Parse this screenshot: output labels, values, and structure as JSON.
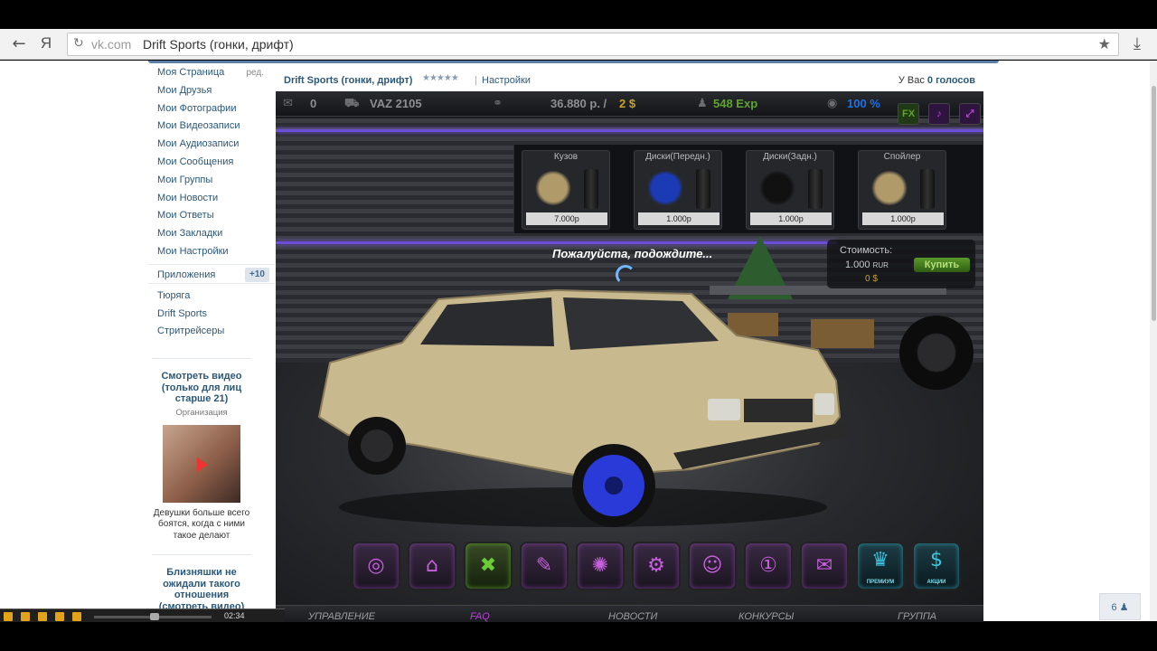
{
  "browser": {
    "url_host": "vk.com",
    "page_title": "Drift Sports (гонки, дрифт)",
    "search_letter": "Я"
  },
  "sidebar": {
    "edit_label": "ред.",
    "items": [
      "Моя Страница",
      "Мои Друзья",
      "Мои Фотографии",
      "Мои Видеозаписи",
      "Мои Аудиозаписи",
      "Мои Сообщения",
      "Мои Группы",
      "Мои Новости",
      "Мои Ответы",
      "Мои Закладки",
      "Мои Настройки"
    ],
    "apps_label": "Приложения",
    "apps_badge": "+10",
    "app_links": [
      "Тюряга",
      "Drift Sports",
      "Стритрейсеры"
    ]
  },
  "ads": [
    {
      "title": "Смотреть видео (только для лиц старше 21)",
      "subtitle": "Организация",
      "desc": "Девушки больше всего боятся, когда с ними такое делают"
    },
    {
      "title": "Близняшки не ожидали такого отношения (смотреть видео)"
    }
  ],
  "app_header": {
    "name": "Drift Sports (гонки, дрифт)",
    "rating_stars": "★★★★★",
    "settings": "Настройки",
    "votes_prefix": "У Вас ",
    "votes_value": "0 голосов"
  },
  "game": {
    "hud": {
      "messages": "0",
      "car": "VAZ 2105",
      "money": "36.880 р. /",
      "gold": "2 $",
      "exp": "548 Exp",
      "fuel": "100 %",
      "fx": "FX"
    },
    "parts": [
      {
        "label": "Кузов",
        "price": "7.000р",
        "color": "#b09a6a"
      },
      {
        "label": "Диски(Передн.)",
        "price": "1.000р",
        "color": "#1b3bb5"
      },
      {
        "label": "Диски(Задн.)",
        "price": "1.000р",
        "color": "#111111"
      },
      {
        "label": "Спойлер",
        "price": "1.000р",
        "color": "#b09a6a"
      }
    ],
    "wait_text": "Пожалуйста, подождите...",
    "cost": {
      "title": "Стоимость:",
      "value": "1.000",
      "currency": "RUR",
      "gold": "0 $",
      "buy": "Купить"
    },
    "toolbar": [
      {
        "icon": "steering-wheel-icon",
        "glyph": "◎"
      },
      {
        "icon": "garage-icon",
        "glyph": "⌂"
      },
      {
        "icon": "tools-icon",
        "glyph": "✖",
        "active": true
      },
      {
        "icon": "tuning-icon",
        "glyph": "✎"
      },
      {
        "icon": "wheel-icon",
        "glyph": "✺"
      },
      {
        "icon": "engine-icon",
        "glyph": "⚙"
      },
      {
        "icon": "friends-icon",
        "glyph": "☺"
      },
      {
        "icon": "rating-icon",
        "glyph": "①"
      },
      {
        "icon": "chat-icon",
        "glyph": "✉"
      },
      {
        "icon": "premium-icon",
        "glyph": "♛",
        "caption": "ПРЕМИУМ",
        "teal": true
      },
      {
        "icon": "dollar-icon",
        "glyph": "$",
        "caption": "АКЦИИ",
        "teal": true
      }
    ],
    "bottom_nav": [
      {
        "label": "УПРАВЛЕНИЕ"
      },
      {
        "label": "FAQ",
        "active": true
      },
      {
        "label": "НОВОСТИ"
      },
      {
        "label": "КОНКУРСЫ"
      },
      {
        "label": "ГРУППА"
      }
    ]
  },
  "media": {
    "time": "02:34"
  },
  "counter": {
    "value": "6"
  },
  "colors": {
    "vk_link": "#2b587a",
    "accent_purple": "#c23fe0",
    "money_gold": "#c8a42a",
    "exp_green": "#5da52e"
  }
}
